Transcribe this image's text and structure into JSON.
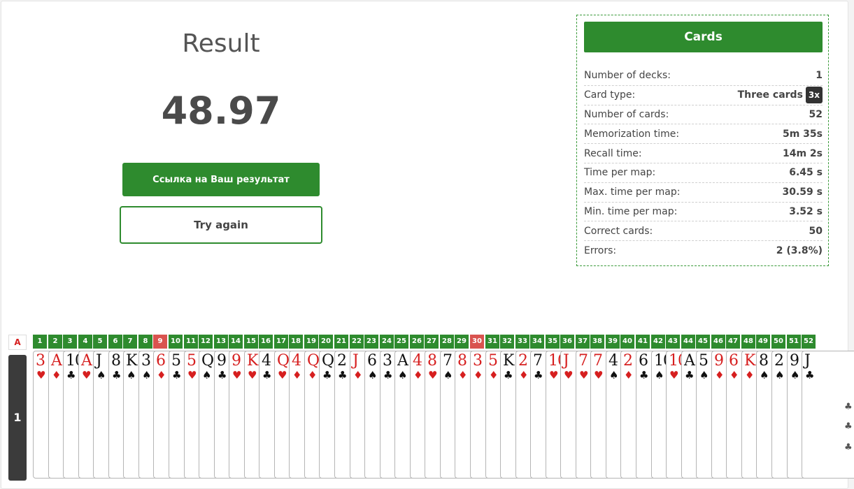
{
  "result": {
    "title": "Result",
    "score": "48.97",
    "link_button": "Ссылка на Ваш результат",
    "try_again_button": "Try again"
  },
  "stats": {
    "header": "Cards",
    "badge": "3x",
    "rows": [
      {
        "label": "Number of decks:",
        "value": "1"
      },
      {
        "label": "Card type:",
        "value": "Three cards"
      },
      {
        "label": "Number of cards:",
        "value": "52"
      },
      {
        "label": "Memorization time:",
        "value": "5m 35s"
      },
      {
        "label": "Recall time:",
        "value": "14m 2s"
      },
      {
        "label": "Time per map:",
        "value": "6.45 s"
      },
      {
        "label": "Max. time per map:",
        "value": "30.59 s"
      },
      {
        "label": "Min. time per map:",
        "value": "3.52 s"
      },
      {
        "label": "Correct cards:",
        "value": "50"
      },
      {
        "label": "Errors:",
        "value": "2 (3.8%)"
      }
    ]
  },
  "recall": {
    "header_label": "A",
    "row_label": "1",
    "error_positions": [
      9,
      30
    ],
    "cards": [
      {
        "n": "1",
        "rank": "3",
        "suit": "♥",
        "color": "red"
      },
      {
        "n": "2",
        "rank": "A",
        "suit": "♦",
        "color": "red"
      },
      {
        "n": "3",
        "rank": "10",
        "suit": "♣",
        "color": "black"
      },
      {
        "n": "4",
        "rank": "A",
        "suit": "♥",
        "color": "red"
      },
      {
        "n": "5",
        "rank": "J",
        "suit": "♠",
        "color": "black"
      },
      {
        "n": "6",
        "rank": "8",
        "suit": "♣",
        "color": "black"
      },
      {
        "n": "7",
        "rank": "K",
        "suit": "♠",
        "color": "black"
      },
      {
        "n": "8",
        "rank": "3",
        "suit": "♠",
        "color": "black"
      },
      {
        "n": "9",
        "rank": "6",
        "suit": "♦",
        "color": "red"
      },
      {
        "n": "10",
        "rank": "5",
        "suit": "♣",
        "color": "black"
      },
      {
        "n": "11",
        "rank": "5",
        "suit": "♥",
        "color": "red"
      },
      {
        "n": "12",
        "rank": "Q",
        "suit": "♠",
        "color": "black"
      },
      {
        "n": "13",
        "rank": "9",
        "suit": "♣",
        "color": "black"
      },
      {
        "n": "14",
        "rank": "9",
        "suit": "♥",
        "color": "red"
      },
      {
        "n": "15",
        "rank": "K",
        "suit": "♥",
        "color": "red"
      },
      {
        "n": "16",
        "rank": "4",
        "suit": "♣",
        "color": "black"
      },
      {
        "n": "17",
        "rank": "Q",
        "suit": "♥",
        "color": "red"
      },
      {
        "n": "18",
        "rank": "4",
        "suit": "♦",
        "color": "red"
      },
      {
        "n": "19",
        "rank": "Q",
        "suit": "♦",
        "color": "red"
      },
      {
        "n": "20",
        "rank": "Q",
        "suit": "♣",
        "color": "black"
      },
      {
        "n": "21",
        "rank": "2",
        "suit": "♣",
        "color": "black"
      },
      {
        "n": "22",
        "rank": "J",
        "suit": "♦",
        "color": "red"
      },
      {
        "n": "23",
        "rank": "6",
        "suit": "♠",
        "color": "black"
      },
      {
        "n": "24",
        "rank": "3",
        "suit": "♣",
        "color": "black"
      },
      {
        "n": "25",
        "rank": "A",
        "suit": "♠",
        "color": "black"
      },
      {
        "n": "26",
        "rank": "4",
        "suit": "♦",
        "color": "red"
      },
      {
        "n": "27",
        "rank": "8",
        "suit": "♥",
        "color": "red"
      },
      {
        "n": "28",
        "rank": "7",
        "suit": "♠",
        "color": "black"
      },
      {
        "n": "29",
        "rank": "8",
        "suit": "♦",
        "color": "red"
      },
      {
        "n": "30",
        "rank": "3",
        "suit": "♦",
        "color": "red"
      },
      {
        "n": "31",
        "rank": "5",
        "suit": "♦",
        "color": "red"
      },
      {
        "n": "32",
        "rank": "K",
        "suit": "♣",
        "color": "black"
      },
      {
        "n": "33",
        "rank": "2",
        "suit": "♦",
        "color": "red"
      },
      {
        "n": "34",
        "rank": "7",
        "suit": "♣",
        "color": "black"
      },
      {
        "n": "35",
        "rank": "10",
        "suit": "♥",
        "color": "red"
      },
      {
        "n": "36",
        "rank": "J",
        "suit": "♥",
        "color": "red"
      },
      {
        "n": "37",
        "rank": "7",
        "suit": "♥",
        "color": "red"
      },
      {
        "n": "38",
        "rank": "7",
        "suit": "♥",
        "color": "red"
      },
      {
        "n": "39",
        "rank": "4",
        "suit": "♠",
        "color": "black"
      },
      {
        "n": "40",
        "rank": "2",
        "suit": "♦",
        "color": "red"
      },
      {
        "n": "41",
        "rank": "6",
        "suit": "♣",
        "color": "black"
      },
      {
        "n": "42",
        "rank": "10",
        "suit": "♠",
        "color": "black"
      },
      {
        "n": "43",
        "rank": "10",
        "suit": "♥",
        "color": "red"
      },
      {
        "n": "44",
        "rank": "A",
        "suit": "♣",
        "color": "black"
      },
      {
        "n": "45",
        "rank": "5",
        "suit": "♠",
        "color": "black"
      },
      {
        "n": "46",
        "rank": "9",
        "suit": "♦",
        "color": "red"
      },
      {
        "n": "47",
        "rank": "6",
        "suit": "♦",
        "color": "red"
      },
      {
        "n": "48",
        "rank": "K",
        "suit": "♦",
        "color": "red"
      },
      {
        "n": "49",
        "rank": "8",
        "suit": "♠",
        "color": "black"
      },
      {
        "n": "50",
        "rank": "2",
        "suit": "♠",
        "color": "black"
      },
      {
        "n": "51",
        "rank": "9",
        "suit": "♠",
        "color": "black"
      },
      {
        "n": "52",
        "rank": "J",
        "suit": "♣",
        "color": "black"
      }
    ]
  }
}
